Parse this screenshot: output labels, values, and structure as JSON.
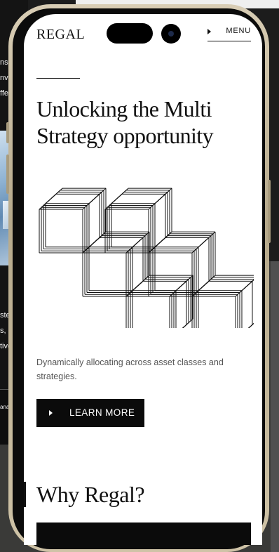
{
  "background": {
    "left_card_lines": [
      "nsiv",
      "nve",
      "ffe",
      "ste",
      "s,",
      "tive",
      "ana"
    ]
  },
  "header": {
    "logo": "REGAL",
    "menu_label": "MENU"
  },
  "hero": {
    "title": "Unlocking the Multi Strategy opportunity",
    "description": "Dynamically allocating across asset classes and strategies.",
    "cta_label": "LEARN MORE"
  },
  "section": {
    "heading": "Why Regal?"
  },
  "colors": {
    "brand_dark": "#0b0b0b",
    "frame_gold": "#cfc3a7",
    "text_muted": "#555555"
  }
}
